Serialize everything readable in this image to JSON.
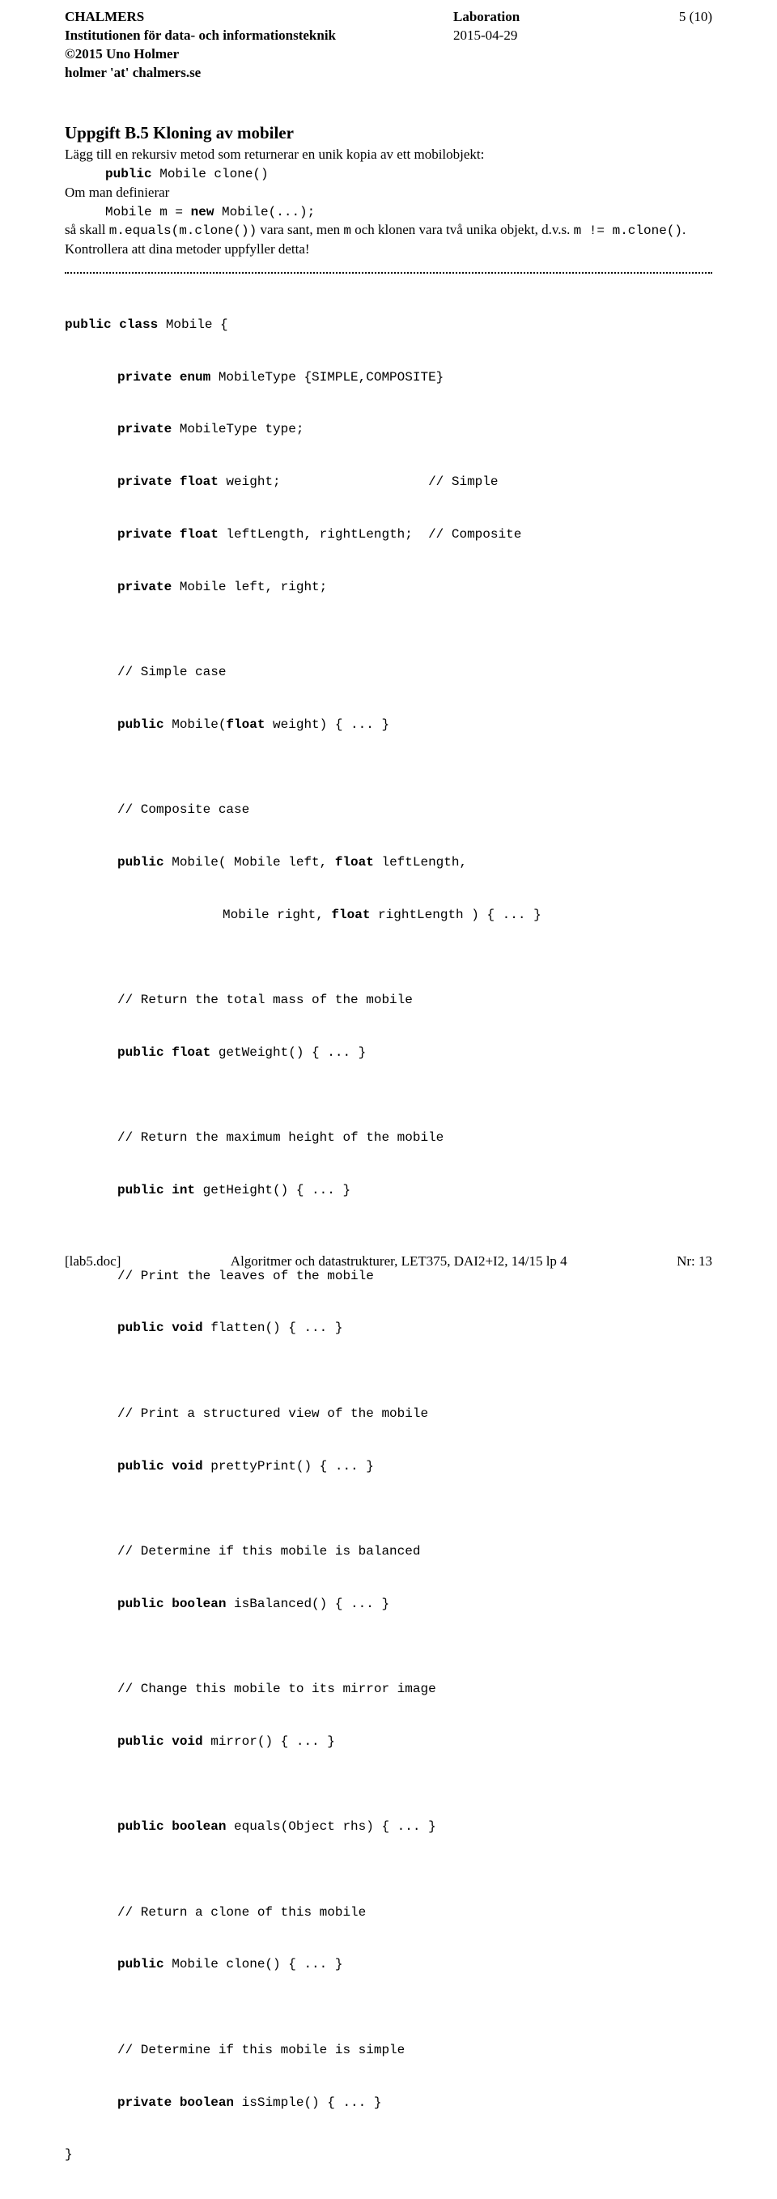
{
  "header": {
    "org": "CHALMERS",
    "dept": "Institutionen för data- och informationsteknik",
    "copyright": "©2015 Uno Holmer",
    "contact": "holmer 'at' chalmers.se",
    "title": "Laboration",
    "date": "2015-04-29",
    "page": "5 (10)"
  },
  "section": {
    "title": "Uppgift B.5   Kloning av mobiler",
    "p1": "Lägg till en rekursiv metod som returnerar en unik kopia av ett mobilobjekt:",
    "sig1_kw": "public",
    "sig1_rest": " Mobile clone()",
    "p2": "Om man definierar",
    "sig2_a": "Mobile m = ",
    "sig2_kw": "new",
    "sig2_b": " Mobile(...);",
    "p3a": "så skall ",
    "p3b": "m.equals(m.clone())",
    "p3c": " vara sant, men ",
    "p3d": "m",
    "p3e": " och klonen vara två unika objekt, d.v.s. ",
    "p3f": "m != m.clone()",
    "p3g": ". Kontrollera att dina metoder uppfyller detta!"
  },
  "code": {
    "l1": "public class",
    "l1b": " Mobile {",
    "l2": "private enum",
    "l2b": " MobileType {SIMPLE,COMPOSITE}",
    "l3": "private",
    "l3b": " MobileType type;",
    "l4": "private float",
    "l4b": " weight;                   // Simple",
    "l5": "private float",
    "l5b": " leftLength, rightLength;  // Composite",
    "l6": "private",
    "l6b": " Mobile left, right;",
    "c1": "// Simple case",
    "l7": "public",
    "l7b": " Mobile(",
    "l7c": "float",
    "l7d": " weight) { ... }",
    "c2": "// Composite case",
    "l8": "public",
    "l8b": " Mobile( Mobile left, ",
    "l8c": "float",
    "l8d": " leftLength,",
    "l8e": "Mobile right, ",
    "l8f": "float",
    "l8g": " rightLength ) { ... }",
    "c3": "// Return the total mass of the mobile",
    "l9": "public float",
    "l9b": " getWeight() { ... }",
    "c4": "// Return the maximum height of the mobile",
    "l10": "public int",
    "l10b": " getHeight() { ... }",
    "c5": "// Print the leaves of the mobile",
    "l11": "public void",
    "l11b": " flatten() { ... }",
    "c6": "// Print a structured view of the mobile",
    "l12": "public void",
    "l12b": " prettyPrint() { ... }",
    "c7": "// Determine if this mobile is balanced",
    "l13": "public boolean",
    "l13b": " isBalanced() { ... }",
    "c8": "// Change this mobile to its mirror image",
    "l14": "public void",
    "l14b": " mirror() { ... }",
    "l15": "public boolean",
    "l15b": " equals(Object rhs) { ... }",
    "c9": "// Return a clone of this mobile",
    "l16": "public",
    "l16b": " Mobile clone() { ... }",
    "c10": "// Determine if this mobile is simple",
    "l17": "private boolean",
    "l17b": " isSimple() { ... }",
    "close": "}"
  },
  "footer": {
    "left": "[lab5.doc]",
    "mid": "Algoritmer och datastrukturer, LET375, DAI2+I2, 14/15 lp 4",
    "right": "Nr: 13"
  }
}
